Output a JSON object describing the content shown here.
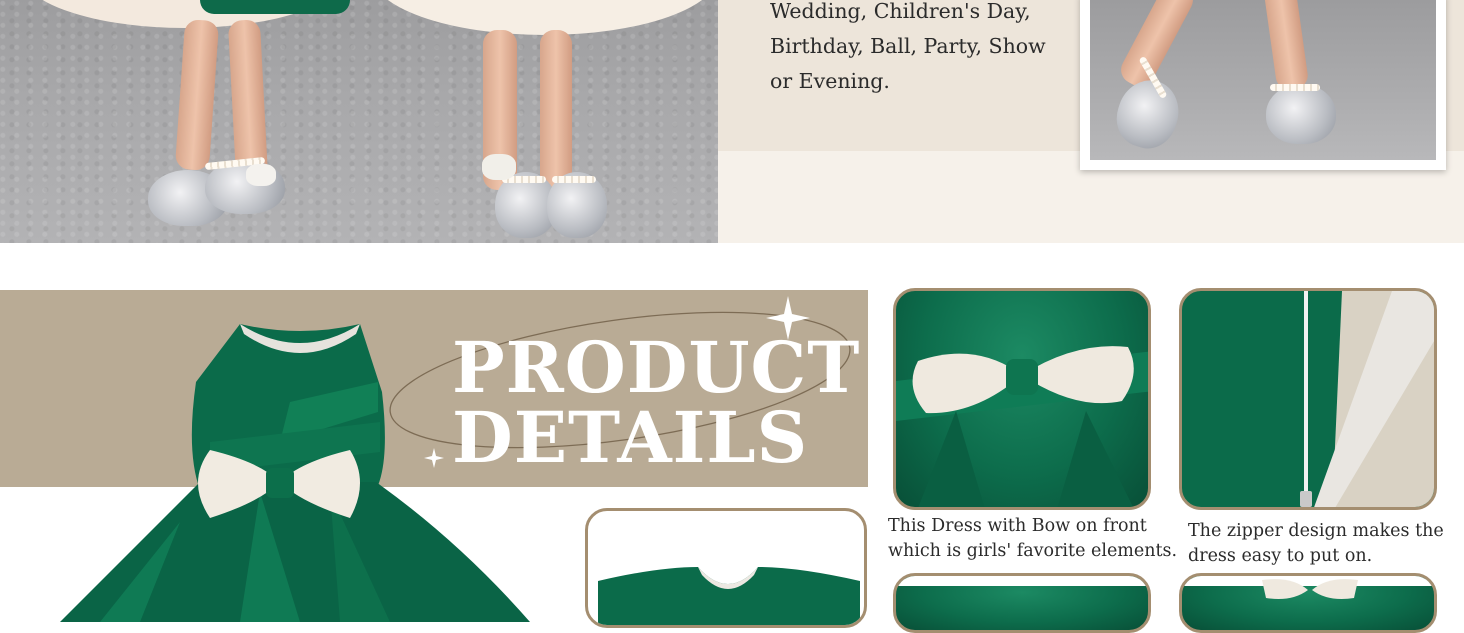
{
  "occasion": {
    "lines": [
      "Wedding, Children's Day,",
      "Birthday, Ball, Party, Show",
      "or Evening."
    ]
  },
  "product_details": {
    "title_line1": "PRODUCT",
    "title_line2": "DETAILS"
  },
  "features": [
    {
      "caption_line1": "This Dress with Bow on front",
      "caption_line2": "which is girls' favorite elements."
    },
    {
      "caption_line1": "The zipper design makes the",
      "caption_line2": "dress easy to put on."
    }
  ],
  "colors": {
    "banner": "#b9ab95",
    "dress_green": "#0b6b4a",
    "frame_border": "#a48e70",
    "cream": "#f6f1ea"
  }
}
